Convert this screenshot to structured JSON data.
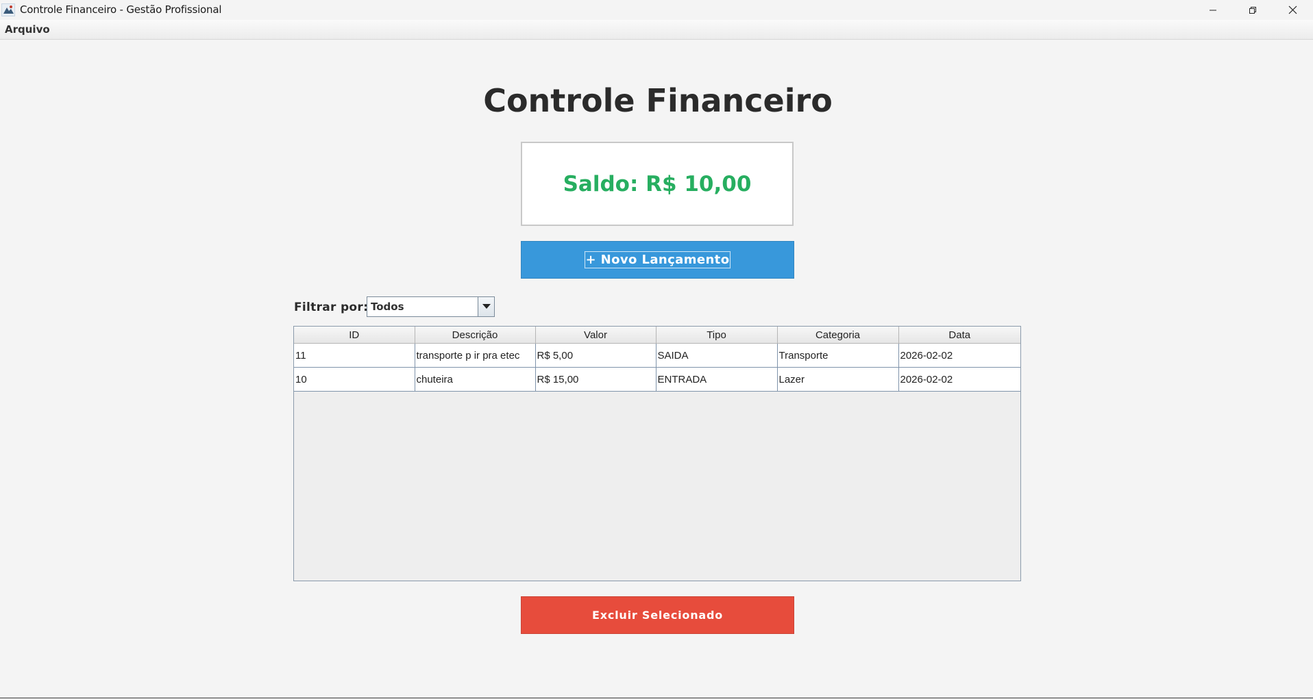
{
  "window": {
    "title": "Controle Financeiro - Gestão Profissional",
    "icons": {
      "app": "java-app-icon",
      "minimize": "minimize-icon",
      "maximize": "restore-icon",
      "close": "close-icon"
    }
  },
  "menu": {
    "items": [
      {
        "label": "Arquivo"
      }
    ]
  },
  "main": {
    "title": "Controle Financeiro",
    "balance_text": "Saldo: R$ 10,00",
    "new_entry_label": "+ Novo Lançamento",
    "filter": {
      "label": "Filtrar por:",
      "selected": "Todos"
    },
    "delete_label": "Excluir Selecionado"
  },
  "colors": {
    "balance": "#27ae60",
    "primary_button": "#3898db",
    "danger_button": "#e74c3c",
    "title": "#2b2b2b"
  },
  "table": {
    "columns": [
      "ID",
      "Descrição",
      "Valor",
      "Tipo",
      "Categoria",
      "Data"
    ],
    "rows": [
      [
        "11",
        "transporte p ir pra etec",
        "R$ 5,00",
        "SAIDA",
        "Transporte",
        "2026-02-02"
      ],
      [
        "10",
        "chuteira",
        "R$ 15,00",
        "ENTRADA",
        "Lazer",
        "2026-02-02"
      ]
    ]
  }
}
